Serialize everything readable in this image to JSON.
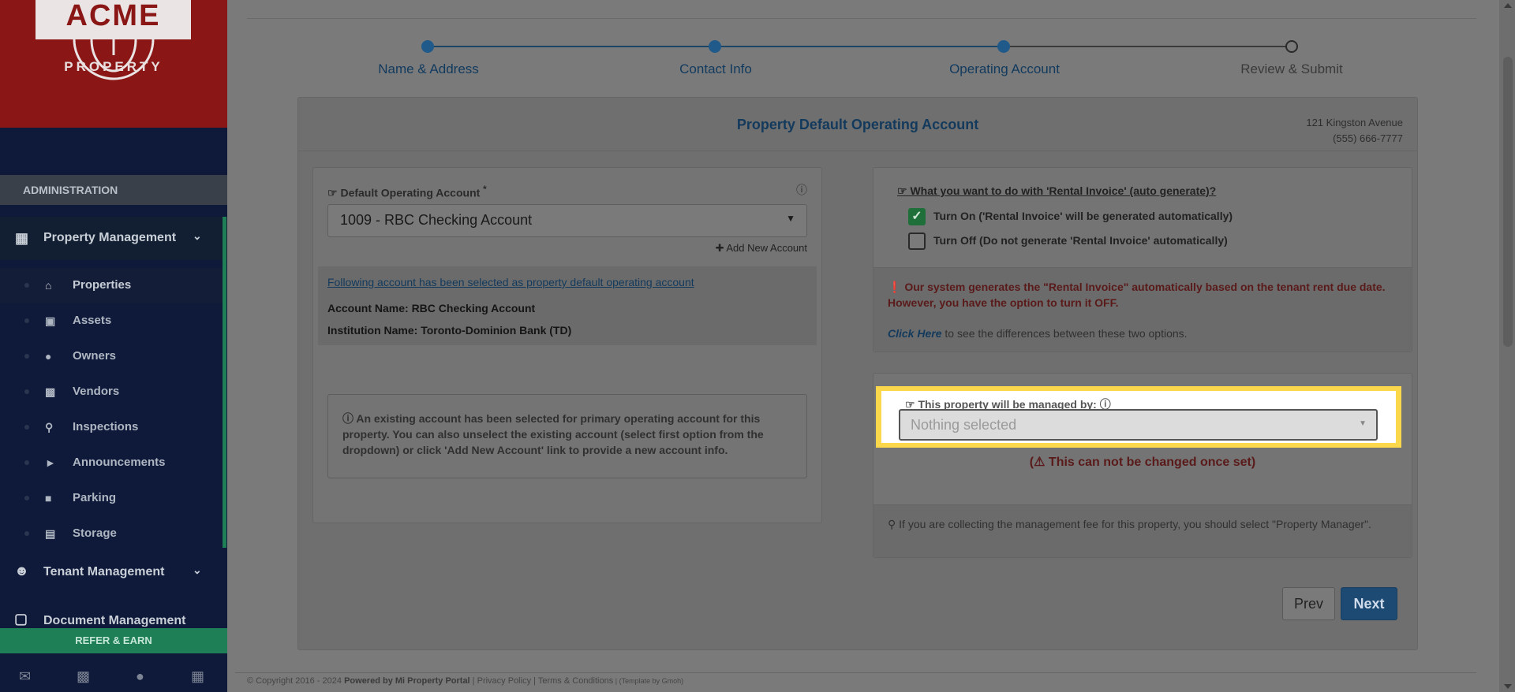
{
  "sidebar": {
    "logo_text": "ACME",
    "logo_sub": "PROPERTY",
    "admin_label": "ADMINISTRATION",
    "property_management": "Property Management",
    "items": [
      {
        "label": "Properties",
        "icon": "home-icon"
      },
      {
        "label": "Assets",
        "icon": "archive-icon"
      },
      {
        "label": "Owners",
        "icon": "user-icon"
      },
      {
        "label": "Vendors",
        "icon": "briefcase-icon"
      },
      {
        "label": "Inspections",
        "icon": "search-icon"
      },
      {
        "label": "Announcements",
        "icon": "bullhorn-icon"
      },
      {
        "label": "Parking",
        "icon": "car-icon"
      },
      {
        "label": "Storage",
        "icon": "basket-icon"
      }
    ],
    "tenant_management": "Tenant Management",
    "document_management": "Document Management",
    "refer_earn": "REFER & EARN"
  },
  "stepper": {
    "steps": [
      {
        "label": "Name & Address",
        "state": "done"
      },
      {
        "label": "Contact Info",
        "state": "done"
      },
      {
        "label": "Operating Account",
        "state": "current"
      },
      {
        "label": "Review & Submit",
        "state": "future"
      }
    ]
  },
  "card": {
    "title": "Property Default Operating Account",
    "address_line1": "121 Kingston Avenue",
    "address_line2": "(555) 666-7777"
  },
  "left": {
    "field_label": "Default Operating Account",
    "required_mark": "*",
    "selected_value": "1009 - RBC Checking Account",
    "add_new": "Add New Account",
    "selected_notice": "Following account has been selected as property default operating account",
    "account_name": "Account Name: RBC Checking Account",
    "institution_name": "Institution Name: Toronto-Dominion Bank (TD)",
    "info_message": "An existing account has been selected for primary operating account for this property. You can also unselect the existing account (select first option from the dropdown) or click 'Add New Account' link to provide a new account info."
  },
  "right_top": {
    "question": "What you want to do with 'Rental Invoice' (auto generate)?",
    "option_on": "Turn On ('Rental Invoice' will be generated automatically)",
    "option_off": "Turn Off (Do not generate 'Rental Invoice' automatically)",
    "notice": "Our system generates the \"Rental Invoice\" automatically based on the tenant rent due date. However, you have the option to turn it OFF.",
    "click_here": "Click Here",
    "click_here_rest": " to see the differences between these two options."
  },
  "right_bottom": {
    "managed_label": "This property will be managed by:",
    "placeholder": "Nothing selected",
    "warning": "This can not be changed once set)",
    "warning_prefix": "(",
    "tip": "If you are collecting the management fee for this property, you should select \"Property Manager\"."
  },
  "buttons": {
    "prev": "Prev",
    "next": "Next"
  },
  "footer": {
    "copyright": "© Copyright 2016 - 2024 ",
    "powered": "Powered by Mi Property Portal",
    "sep1": " | ",
    "privacy": "Privacy Policy",
    "sep2": " | ",
    "terms": "Terms & Conditions",
    "template": " | (Template by Gmoh)"
  }
}
